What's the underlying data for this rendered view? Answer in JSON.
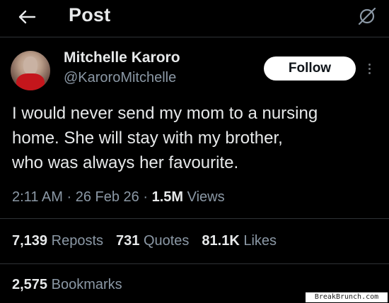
{
  "header": {
    "title": "Post",
    "back_icon": "arrow-left-icon",
    "grok_icon": "grok-icon"
  },
  "author": {
    "name": "Mitchelle Karoro",
    "handle": "@KaroroMitchelle",
    "avatar_icon": "profile-photo"
  },
  "follow_label": "Follow",
  "more_icon": "more-vertical-icon",
  "tweet": {
    "lines": [
      "I would never send my mom to a nursing",
      "home. She will stay with my brother,",
      "who was always her favourite."
    ]
  },
  "meta": {
    "time": "2:11 AM",
    "separator": "·",
    "date": "26 Feb 26",
    "views_count": "1.5M",
    "views_label": "Views"
  },
  "stats": {
    "reposts_count": "7,139",
    "reposts_label": "Reposts",
    "quotes_count": "731",
    "quotes_label": "Quotes",
    "likes_count": "81.1K",
    "likes_label": "Likes",
    "bookmarks_count": "2,575",
    "bookmarks_label": "Bookmarks"
  },
  "watermark": "BreakBrunch.com",
  "colors": {
    "background": "#000000",
    "primary_text": "#e7e9ea",
    "secondary_text": "#8b98a5",
    "divider": "#2f3336",
    "follow_button_bg": "#ffffff"
  }
}
